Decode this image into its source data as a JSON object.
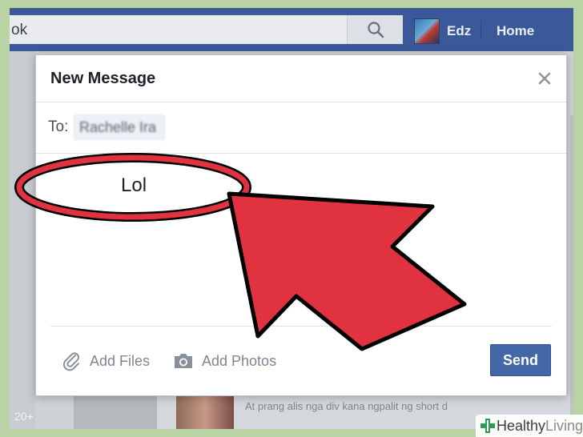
{
  "topbar": {
    "search_text": "ok",
    "user_name": "Edz",
    "home_label": "Home"
  },
  "background": {
    "count_badge": "20+",
    "post_line": "At prang alis nga div kana ngpalit ng short d"
  },
  "dialog": {
    "title": "New Message",
    "to_label": "To:",
    "recipient": "Rachelle Ira",
    "message": "Lol",
    "add_files_label": "Add Files",
    "add_photos_label": "Add Photos",
    "send_label": "Send"
  },
  "annotation": {
    "color": "#e0323f",
    "outline": "#000000"
  },
  "watermark": {
    "brand": "Healthy",
    "brand_suffix": "Living",
    "logo_color": "#2e9b58"
  }
}
